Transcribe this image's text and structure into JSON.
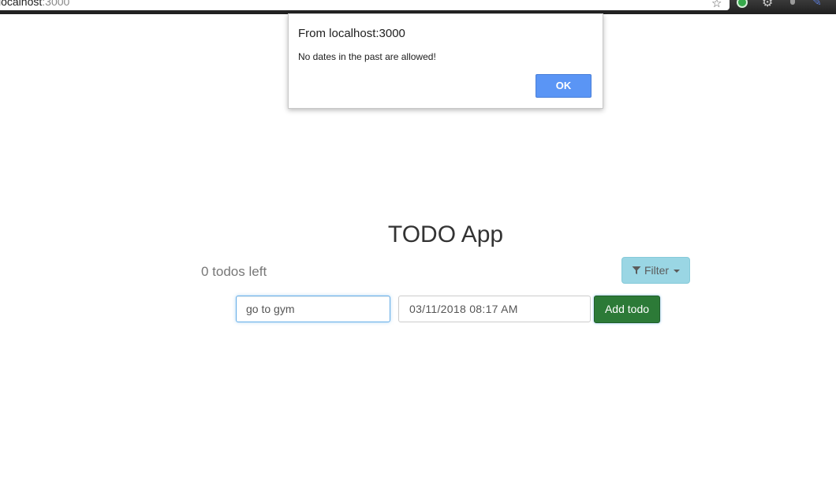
{
  "browser": {
    "url_host": "localhost",
    "url_port": ":3000",
    "star_icon": "star-icon",
    "extension_icons": [
      "green-extension-icon",
      "gear-icon",
      "dot-icon",
      "pen-icon"
    ]
  },
  "dialog": {
    "title": "From localhost:3000",
    "message": "No dates in the past are allowed!",
    "ok_label": "OK",
    "ok_color": "#5a95f5"
  },
  "app": {
    "title": "TODO App",
    "todos_left": "0 todos left",
    "filter_label": "Filter",
    "filter_icon": "funnel-icon",
    "todo_input_value": "go to gym",
    "date_input_value": "03/11/2018 08:17 AM",
    "add_label": "Add todo",
    "filter_color": "#9ad6e4",
    "add_color": "#2c7a37"
  }
}
